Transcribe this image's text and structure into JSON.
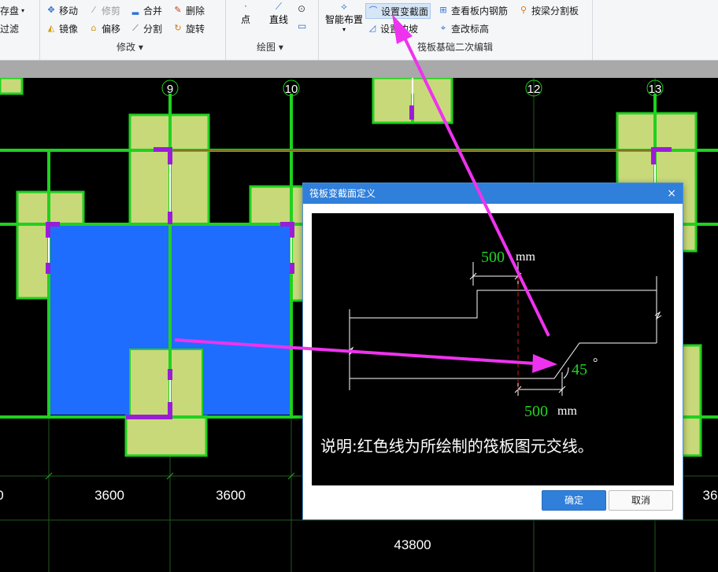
{
  "ribbon": {
    "group_edit": {
      "title": "修改",
      "left_partial": [
        "存盘",
        "过滤"
      ],
      "row1": [
        "移动",
        "修剪",
        "合并",
        "删除"
      ],
      "row2": [
        "镜像",
        "偏移",
        "分割",
        "旋转"
      ]
    },
    "group_draw": {
      "title": "绘图",
      "point": "点",
      "line": "直线"
    },
    "group_raft": {
      "title": "筏板基础二次编辑",
      "smart_layout": "智能布置",
      "set_section": "设置变截面",
      "set_slope": "设置边坡",
      "view_rebar": "查看板内钢筋",
      "split_by_beam": "按梁分割板",
      "change_elev": "查改标高"
    }
  },
  "axis_labels": [
    "9",
    "10",
    "12",
    "13"
  ],
  "dimensions": {
    "d1": "0",
    "d2": "3600",
    "d3": "3600",
    "d4": "36",
    "total": "43800"
  },
  "dialog": {
    "title": "筏板变截面定义",
    "close_glyph": "×",
    "top_dim_value": "500",
    "top_dim_unit": "mm",
    "angle_value": "45",
    "angle_unit": "°",
    "bottom_dim_value": "500",
    "bottom_dim_unit": "mm",
    "note": "说明:红色线为所绘制的筏板图元交线。",
    "ok_label": "确定",
    "cancel_label": "取消"
  },
  "colors": {
    "canvas_bg": "#000000",
    "pad_fill": "#c8d97a",
    "pad_border": "#1fd11f",
    "slab_fill": "#1f6dff",
    "marker": "#9a1dd6",
    "grid_line": "#2fa82f",
    "arrow": "#ee33ee",
    "dim_green": "#21d321",
    "title_bar": "#2f7fdb"
  }
}
